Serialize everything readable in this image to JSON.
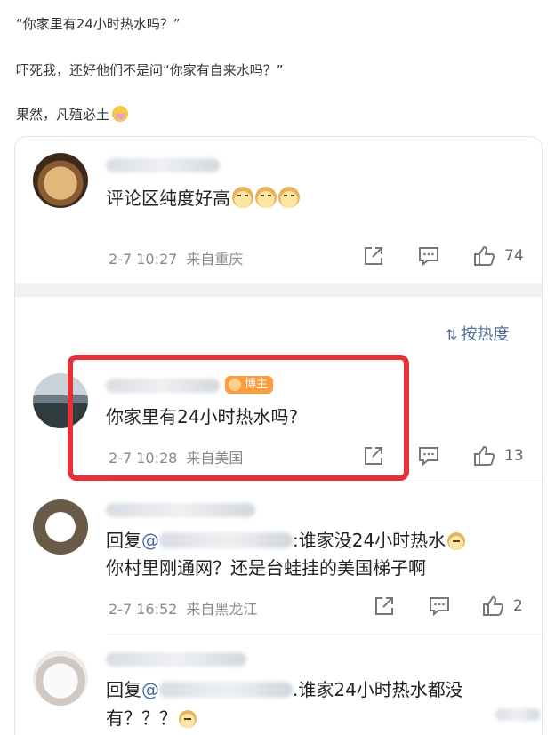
{
  "post": {
    "line1": "“你家里有24小时热水吗？”",
    "line2": "吓死我，还好他们不是问“你家有自来水吗？”",
    "line3": "果然，凡殖必土"
  },
  "comments": [
    {
      "text": "评论区纯度好高",
      "time": "2-7 10:27",
      "location": "来自重庆",
      "likes": "74"
    },
    {
      "badge": "博主",
      "text": "你家里有24小时热水吗?",
      "time": "2-7 10:28",
      "location": "来自美国",
      "likes": "13"
    },
    {
      "reply_prefix": "回复",
      "mention": "@",
      "text_line1": ":谁家没24小时热水",
      "text_line2": "你村里刚通网？还是台蛙挂的美国梯子啊",
      "time": "2-7 16:52",
      "location": "来自黑龙江",
      "likes": "2"
    },
    {
      "reply_prefix": "回复",
      "mention": "@",
      "text_line1": ".谁家24小时热水都没",
      "text_line2": "有？？？"
    }
  ],
  "sort": {
    "label": "按热度"
  },
  "colors": {
    "highlight": "#e63038",
    "badge": "#ff9b3c",
    "link": "#4f6f99"
  }
}
